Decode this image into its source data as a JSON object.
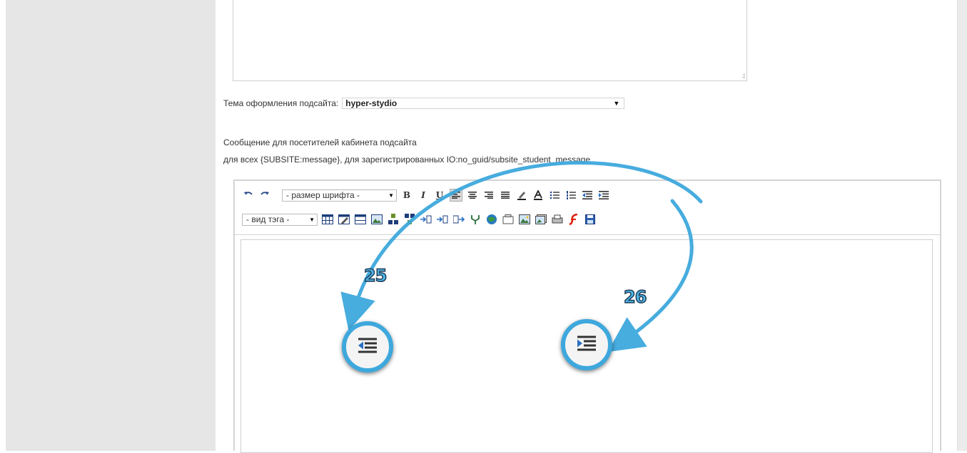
{
  "layout_colors": {
    "sidebar": "#e6e6e6",
    "accent_arrow": "#3ea8dd",
    "border": "#d4d4d4"
  },
  "theme": {
    "label": "Тема оформления подсайта:",
    "selected": "hyper-stydio"
  },
  "message": {
    "line1": "Сообщение для посетителей кабинета подсайта",
    "line2": "для всех {SUBSITE:message}, для зарегистрированных IO:no_guid/subsite_student_message"
  },
  "editor": {
    "font_size_select": "- размер шрифта -",
    "tag_type_select": "- вид тэга -",
    "toolbar_row1_icons": [
      "undo-icon",
      "redo-icon",
      "bold-icon",
      "italic-icon",
      "underline-icon",
      "align-left-icon",
      "align-center-icon",
      "align-right-icon",
      "align-justify-icon",
      "highlight-icon",
      "font-color-icon",
      "unordered-list-icon",
      "ordered-list-icon",
      "outdent-icon",
      "indent-icon"
    ],
    "toolbar_row2_icons": [
      "table-icon",
      "table-edit-icon",
      "table-props-icon",
      "table-image-icon",
      "insert-row-before-icon",
      "insert-row-after-icon",
      "insert-col-before-icon",
      "insert-col-after-icon",
      "delete-col-icon",
      "split-cell-icon",
      "link-icon",
      "anchor-icon",
      "image-icon",
      "image-gallery-icon",
      "print-icon",
      "flash-icon",
      "save-icon"
    ]
  },
  "callouts": [
    {
      "number": "25",
      "icon": "outdent-icon"
    },
    {
      "number": "26",
      "icon": "indent-icon"
    }
  ]
}
